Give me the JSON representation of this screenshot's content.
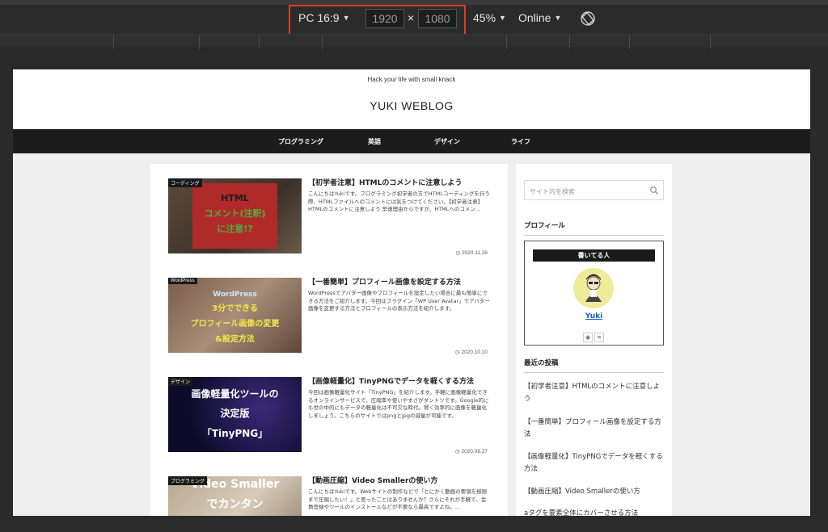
{
  "devtools": {
    "device": "PC 16:9",
    "width": "1920",
    "height": "1080",
    "times": "×",
    "zoom": "45%",
    "network": "Online"
  },
  "site": {
    "tagline": "Hack your life with small knack",
    "title": "YUKI WEBLOG",
    "nav": [
      "プログラミング",
      "英語",
      "デザイン",
      "ライフ"
    ]
  },
  "posts": [
    {
      "category": "コーディング",
      "thumb_lines": [
        "HTML",
        "コメント(注釈)",
        "に注意!?"
      ],
      "title": "【初学者注意】HTMLのコメントに注意しよう",
      "excerpt": "こんにちはYukiです。プログラミング初学者の方でHTMLコーディングを行う際、HTMLファイルへのコメントには気をつけてください。【初学者注意】HTMLのコメントに注意しよう 早速理由からですが、HTMLへのコメン...",
      "date": "2020.11.26"
    },
    {
      "category": "WordPress",
      "thumb_lines": [
        "WordPress",
        "3分でできる",
        "プロフィール画像の変更",
        "&設定方法"
      ],
      "title": "【一番簡単】プロフィール画像を設定する方法",
      "excerpt": "WordPressでアバター画像やプロフィールを設定したい場合に最も簡単にできる方法をご紹介します。今回はプラグイン「WP User Avatar」でアバター画像を変更する方法とプロフィールの表示方法を紹介します。",
      "date": "2020.10.10"
    },
    {
      "category": "デザイン",
      "thumb_lines": [
        "画像軽量化ツールの",
        "決定版",
        "「TinyPNG」"
      ],
      "title": "【画像軽量化】TinyPNGでデータを軽くする方法",
      "excerpt": "今回は画像軽量化サイト「TinyPNG」を紹介します。手軽に画像軽量化できるオンラインサービスで、圧縮率や使いやすさがダントツです。Google的にも世の中的にもデータの軽量化は不可欠な時代。賢く効率的に画像を軽量化しましょう。こちらのサイトではpngとjpgの減量が可能です。",
      "date": "2020.09.27"
    },
    {
      "category": "プログラミング",
      "thumb_lines": [
        "Video Smaller",
        "でカンタン"
      ],
      "title": "【動画圧縮】Video Smallerの使い方",
      "excerpt": "こんにちはYukiです。Webサイトの制作などで「とにかく動画の要領を極限まで圧縮したい！」と思ったことはありませんか？さらにそれが手軽で、会員登録やツールのインストールなどが不要なら最高ですよね。...",
      "date": ""
    }
  ],
  "sidebar": {
    "search_placeholder": "サイト内を検索",
    "profile_title": "プロフィール",
    "profile_head": "書いてる人",
    "profile_name": "Yuki",
    "recent_title": "最近の投稿",
    "recent": [
      "【初学者注意】HTMLのコメントに注意しよう",
      "【一番簡単】プロフィール画像を設定する方法",
      "【画像軽量化】TinyPNGでデータを軽くする方法",
      "【動画圧縮】Video Smallerの使い方",
      "aタグを要素全体にカバーさせる方法"
    ]
  },
  "colors": {
    "highlight": "#e0392b",
    "nav_bg": "#1c1c1c",
    "link": "#1a5fb4"
  }
}
